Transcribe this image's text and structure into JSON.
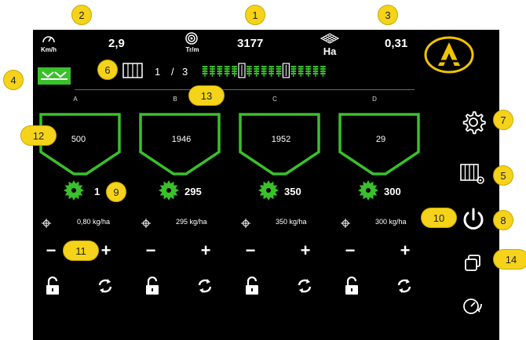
{
  "header": {
    "speed": {
      "value": "2,9",
      "unit": "Km/h",
      "icon": "speedometer-icon"
    },
    "rotation": {
      "value": "3177",
      "unit": "Tr/m",
      "icon": "rotation-icon"
    },
    "area": {
      "value": "0,31",
      "unit": "Ha",
      "icon": "area-grid-icon"
    },
    "rows_indicator": {
      "current": "1",
      "separator": "/",
      "total": "3"
    }
  },
  "markers": [
    "1",
    "2",
    "3",
    "4",
    "5",
    "6",
    "7",
    "8",
    "9",
    "10",
    "11",
    "12",
    "13",
    "14"
  ],
  "columns": [
    {
      "letter": "A",
      "hopper_value": "500",
      "rate": "1",
      "kg_ha": "0,80 kg/ha"
    },
    {
      "letter": "B",
      "hopper_value": "1946",
      "rate": "295",
      "kg_ha": "295 kg/ha"
    },
    {
      "letter": "C",
      "hopper_value": "1952",
      "rate": "350",
      "kg_ha": "350 kg/ha"
    },
    {
      "letter": "D",
      "hopper_value": "29",
      "rate": "300",
      "kg_ha": "300 kg/ha"
    }
  ],
  "controls": {
    "minus": "−",
    "plus": "+"
  },
  "sidebar": {
    "items": [
      {
        "name": "settings",
        "icon": "gear-icon"
      },
      {
        "name": "machine-config",
        "icon": "seeder-config-icon"
      },
      {
        "name": "power",
        "icon": "power-icon"
      },
      {
        "name": "copy",
        "icon": "copy-icon"
      },
      {
        "name": "calibration",
        "icon": "timer-refresh-icon"
      }
    ]
  },
  "colors": {
    "accent_green": "#39c12b",
    "marker_yellow": "#f5d31a",
    "background": "#000000",
    "logo_yellow": "#f2c400"
  }
}
